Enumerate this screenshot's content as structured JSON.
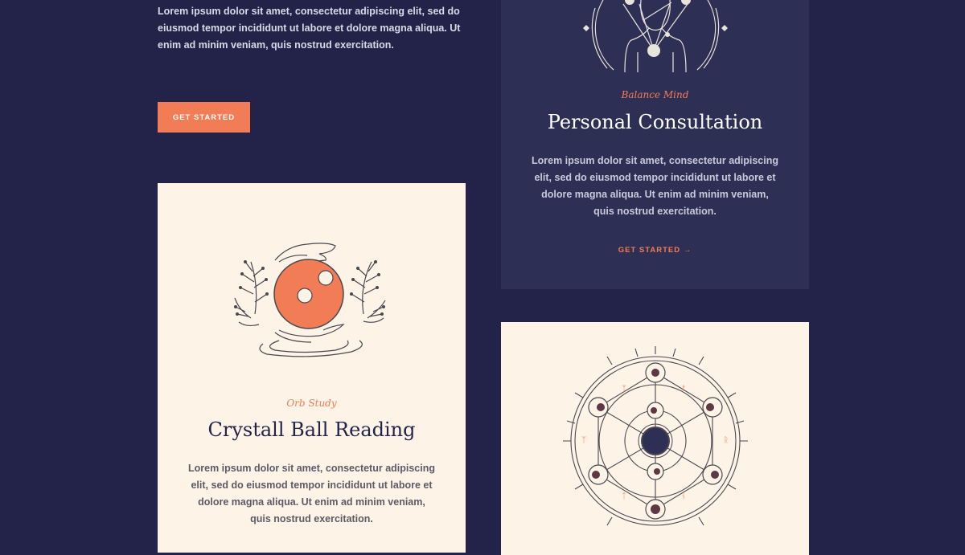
{
  "intro": {
    "text": "Lorem ipsum dolor sit amet, consectetur adipiscing elit, sed do eiusmod tempor incididunt ut labore et dolore magna aliqua. Ut enim ad minim veniam, quis nostrud exercitation.",
    "cta_label": "GET STARTED"
  },
  "cards": {
    "personal": {
      "kicker": "Balance Mind",
      "title": "Personal Consultation",
      "body": "Lorem ipsum dolor sit amet, consectetur adipiscing elit, sed do eiusmod tempor incididunt ut labore et dolore magna aliqua. Ut enim ad minim veniam, quis nostrud exercitation.",
      "cta_label": "GET STARTED →",
      "icon": "figure-constellation-icon"
    },
    "crystal": {
      "kicker": "Orb Study",
      "title": "Crystall Ball Reading",
      "body": "Lorem ipsum dolor sit amet, consectetur adipiscing elit, sed do eiusmod tempor incididunt ut labore et dolore magna aliqua. Ut enim ad minim veniam, quis nostrud exercitation.",
      "icon": "crystal-ball-icon"
    },
    "mandala": {
      "icon": "moon-phases-mandala-icon"
    }
  },
  "colors": {
    "background": "#23234a",
    "card_dark": "#2e2f55",
    "card_light": "#fdf3e6",
    "accent": "#f27c55"
  }
}
